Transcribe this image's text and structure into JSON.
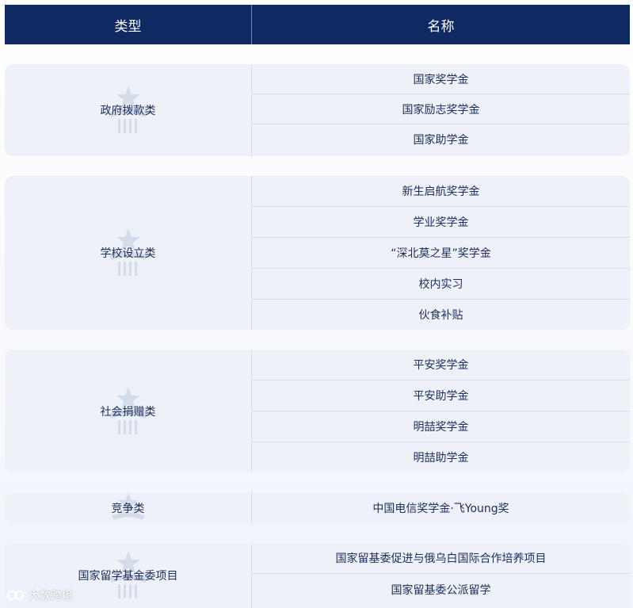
{
  "header": {
    "type_label": "类型",
    "name_label": "名称"
  },
  "groups": [
    {
      "type": "政府拨款类",
      "names": [
        "国家奖学金",
        "国家励志奖学金",
        "国家助学金"
      ]
    },
    {
      "type": "学校设立类",
      "names": [
        "新生启航奖学金",
        "学业奖学金",
        "“深北莫之星”奖学金",
        "校内实习",
        "伙食补贴"
      ]
    },
    {
      "type": "社会捐赠类",
      "names": [
        "平安奖学金",
        "平安助学金",
        "明喆奖学金",
        "明喆助学金"
      ]
    },
    {
      "type": "竞争类",
      "names": [
        "中国电信奖学金·飞Young奖"
      ]
    },
    {
      "type": "国家留学基金委项目",
      "names": [
        "国家留基委促进与俄乌白国际合作培养项目",
        "国家留基委公派留学"
      ]
    }
  ],
  "watermark": {
    "text": "大数跨境"
  },
  "colors": {
    "header_bg": "#0f2a63",
    "group_bg": "#eef1f8",
    "text": "#1b2d5c"
  }
}
